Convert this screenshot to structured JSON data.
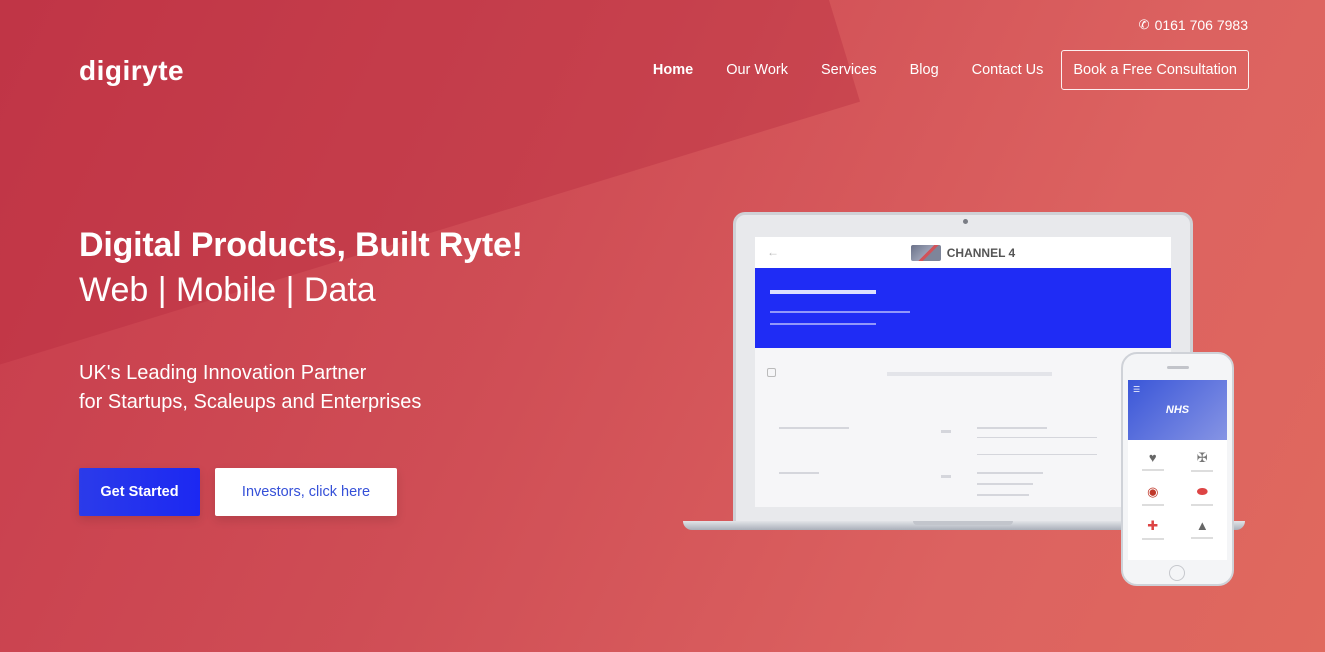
{
  "header": {
    "phone_icon": "phone-icon",
    "phone": "0161 706 7983",
    "logo": "digiryte"
  },
  "nav": {
    "items": [
      {
        "label": "Home",
        "active": true
      },
      {
        "label": "Our Work"
      },
      {
        "label": "Services"
      },
      {
        "label": "Blog"
      },
      {
        "label": "Contact Us"
      }
    ],
    "cta_label": "Book a Free Consultation"
  },
  "hero": {
    "title": "Digital Products, Built Ryte!",
    "subtitle": "Web | Mobile | Data",
    "tagline_line1": "UK's Leading Innovation Partner",
    "tagline_line2": "for Startups, Scaleups and Enterprises",
    "primary_button": "Get Started",
    "secondary_button": "Investors, click here"
  },
  "mockup": {
    "laptop_screen_title": "CHANNEL 4",
    "phone_screen_title": "NHS"
  },
  "colors": {
    "accent_blue": "#1f2cf5",
    "bg_red": "#cf4d55"
  }
}
